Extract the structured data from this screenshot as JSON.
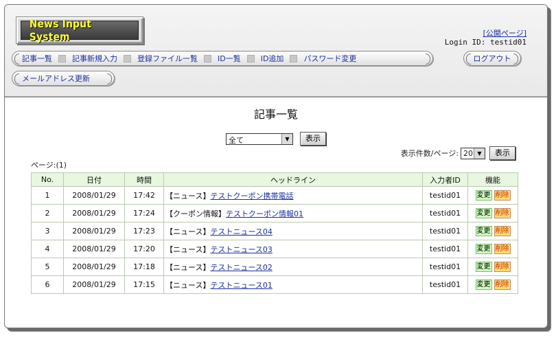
{
  "header": {
    "logo_text": "News Input System",
    "public_link": "[公開ページ]",
    "login_id": "Login ID: testid01"
  },
  "nav": {
    "items": [
      "記事一覧",
      "記事新規入力",
      "登録ファイル一覧",
      "ID一覧",
      "ID追加",
      "パスワード変更"
    ],
    "logout": "ログアウト",
    "mail_update": "メールアドレス更新"
  },
  "main": {
    "title": "記事一覧",
    "filter": {
      "selected": "全て",
      "button": "表示"
    },
    "page_count": "ページ:(1)",
    "per_page": {
      "label": "表示件数/ページ:",
      "selected": "20",
      "button": "表示"
    }
  },
  "table": {
    "headers": [
      "No.",
      "日付",
      "時間",
      "ヘッドライン",
      "入力者ID",
      "機能"
    ],
    "rows": [
      {
        "no": "1",
        "date": "2008/01/29",
        "time": "17:42",
        "category": "【ニュース】",
        "headline": "テストクーポン携帯電話",
        "user": "testid01",
        "edit": "変更",
        "delete": "削除"
      },
      {
        "no": "2",
        "date": "2008/01/29",
        "time": "17:24",
        "category": "【クーポン情報】",
        "headline": "テストクーポン情報01",
        "user": "testid01",
        "edit": "変更",
        "delete": "削除"
      },
      {
        "no": "3",
        "date": "2008/01/29",
        "time": "17:23",
        "category": "【ニュース】",
        "headline": "テストニュース04",
        "user": "testid01",
        "edit": "変更",
        "delete": "削除"
      },
      {
        "no": "4",
        "date": "2008/01/29",
        "time": "17:20",
        "category": "【ニュース】",
        "headline": "テストニュース03",
        "user": "testid01",
        "edit": "変更",
        "delete": "削除"
      },
      {
        "no": "5",
        "date": "2008/01/29",
        "time": "17:18",
        "category": "【ニュース】",
        "headline": "テストニュース02",
        "user": "testid01",
        "edit": "変更",
        "delete": "削除"
      },
      {
        "no": "6",
        "date": "2008/01/29",
        "time": "17:15",
        "category": "【ニュース】",
        "headline": "テストニュース01",
        "user": "testid01",
        "edit": "変更",
        "delete": "削除"
      }
    ]
  },
  "colors": {
    "link": "#1a2fa0",
    "logo_text": "#ffff33",
    "table_header_bg": "#e8f7e0",
    "edit_bg": "#cfffc0",
    "delete_bg": "#ffe070",
    "delete_text": "#cc2200"
  }
}
